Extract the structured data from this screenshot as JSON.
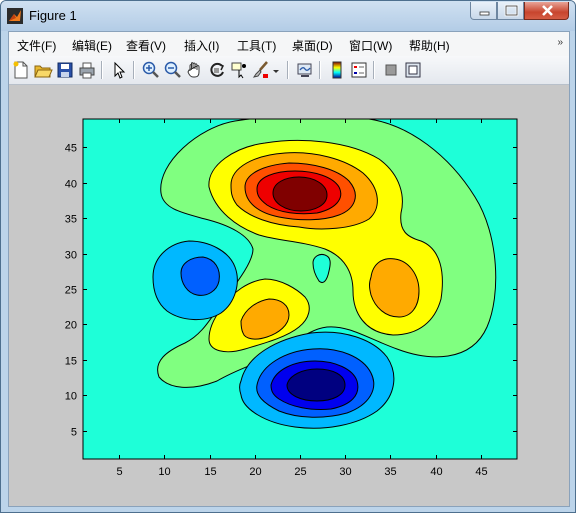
{
  "window": {
    "title": "Figure 1"
  },
  "menu": {
    "items": [
      "文件(F)",
      "编辑(E)",
      "查看(V)",
      "插入(I)",
      "工具(T)",
      "桌面(D)",
      "窗口(W)",
      "帮助(H)"
    ],
    "overflow_icon": "chevron-double-icon"
  },
  "toolbar": {
    "buttons": [
      "new-figure-icon",
      "open-file-icon",
      "save-icon",
      "print-icon",
      "edit-plot-arrow-icon",
      "zoom-in-icon",
      "zoom-out-icon",
      "pan-hand-icon",
      "rotate-3d-icon",
      "data-cursor-icon",
      "brush-icon",
      "brush-dropdown-icon",
      "link-plot-icon",
      "insert-colorbar-icon",
      "insert-legend-icon",
      "hide-plot-tools-icon",
      "show-plot-tools-icon"
    ]
  },
  "chart_data": {
    "type": "contourf",
    "title": "",
    "xlabel": "",
    "ylabel": "",
    "xlim": [
      1,
      49
    ],
    "ylim": [
      1,
      49
    ],
    "xticks": [
      5,
      10,
      15,
      20,
      25,
      30,
      35,
      40,
      45
    ],
    "yticks": [
      5,
      10,
      15,
      20,
      25,
      30,
      35,
      40,
      45
    ],
    "colormap": "jet",
    "colors": {
      "background": "#1effd8",
      "level_plus1": "#80ff80",
      "level_plus2": "#ffff00",
      "level_plus3": "#ffaa00",
      "level_plus4": "#ff5000",
      "level_plus5": "#ee0000",
      "level_plus6": "#800000",
      "level_minus1": "#00b8ff",
      "level_minus2": "#0060ff",
      "level_minus3": "#0000ee",
      "level_minus4": "#000080"
    },
    "features": [
      {
        "name": "peak",
        "center": [
          25,
          38
        ],
        "levels": 6
      },
      {
        "name": "secondary peak",
        "center": [
          35.5,
          24.5
        ],
        "levels": 3
      },
      {
        "name": "small peak",
        "center": [
          21.5,
          20
        ],
        "levels": 3
      },
      {
        "name": "trough",
        "center": [
          26.5,
          12
        ],
        "levels": 4
      },
      {
        "name": "small trough",
        "center": [
          13.5,
          26.5
        ],
        "levels": 2
      },
      {
        "name": "dip",
        "center": [
          27,
          27
        ],
        "levels": 1
      }
    ]
  }
}
